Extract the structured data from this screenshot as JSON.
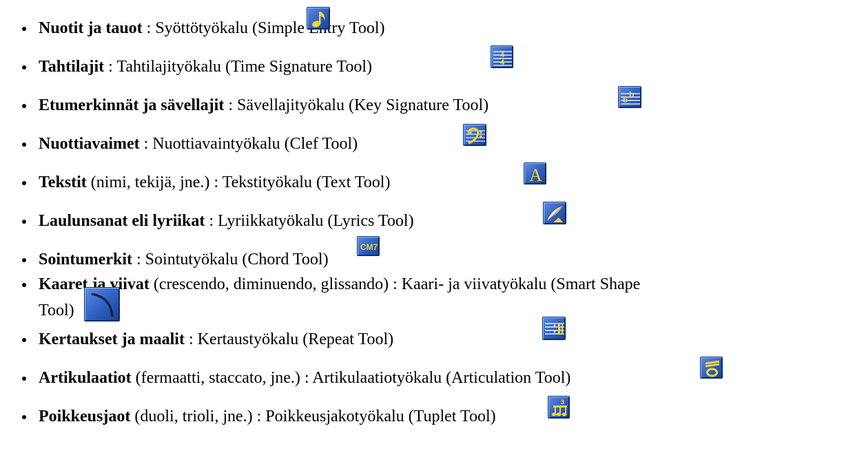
{
  "items": [
    {
      "bold": "Nuotit ja tauot",
      "rest": " : Syöttötyökalu (Simple Entry Tool)",
      "icon": "eighth-note-icon"
    },
    {
      "bold": "Tahtilajit",
      "rest": " : Tahtilajityökalu (Time Signature Tool)",
      "icon": "time-signature-icon"
    },
    {
      "bold": "Etumerkinnät ja sävellajit",
      "rest": " : Sävellajityökalu (Key Signature Tool)",
      "icon": "key-signature-icon"
    },
    {
      "bold": "Nuottiavaimet",
      "rest": " : Nuottiavaintyökalu (Clef Tool)",
      "icon": "bass-clef-icon"
    },
    {
      "bold": "Tekstit",
      "rest": " (nimi, tekijä, jne.) : Tekstityökalu (Text Tool)",
      "icon": "text-tool-icon"
    },
    {
      "bold": "Laulunsanat eli lyriikat",
      "rest": " : Lyriikkatyökalu (Lyrics Tool)",
      "icon": "quill-pen-icon"
    },
    {
      "bold": "Sointumerkit",
      "rest": " : Sointutyökalu (Chord Tool)",
      "icon": "chord-icon"
    },
    {
      "bold": "Kaaret ja viivat",
      "rest": " (crescendo, diminuendo, glissando) : Kaari- ja viivatyökalu (Smart Shape",
      "rest2": "Tool)",
      "icon": "smart-shape-icon"
    },
    {
      "bold": "Kertaukset ja maalit",
      "rest": " : Kertaustyökalu (Repeat Tool)",
      "icon": "repeat-icon"
    },
    {
      "bold": "Artikulaatiot",
      "rest": " (fermaatti, staccato, jne.) : Artikulaatiotyökalu (Articulation Tool)",
      "icon": "articulation-icon"
    },
    {
      "bold": "Poikkeusjaot",
      "rest": " (duoli, trioli, jne.) : Poikkeusjakotyökalu (Tuplet Tool)",
      "icon": "tuplet-icon"
    }
  ],
  "chord_icon_label": "CM7",
  "text_icon_label": "A",
  "colors": {
    "icon_blue": "#2e5fc1",
    "glyph_yellow": "#f2d33a"
  }
}
